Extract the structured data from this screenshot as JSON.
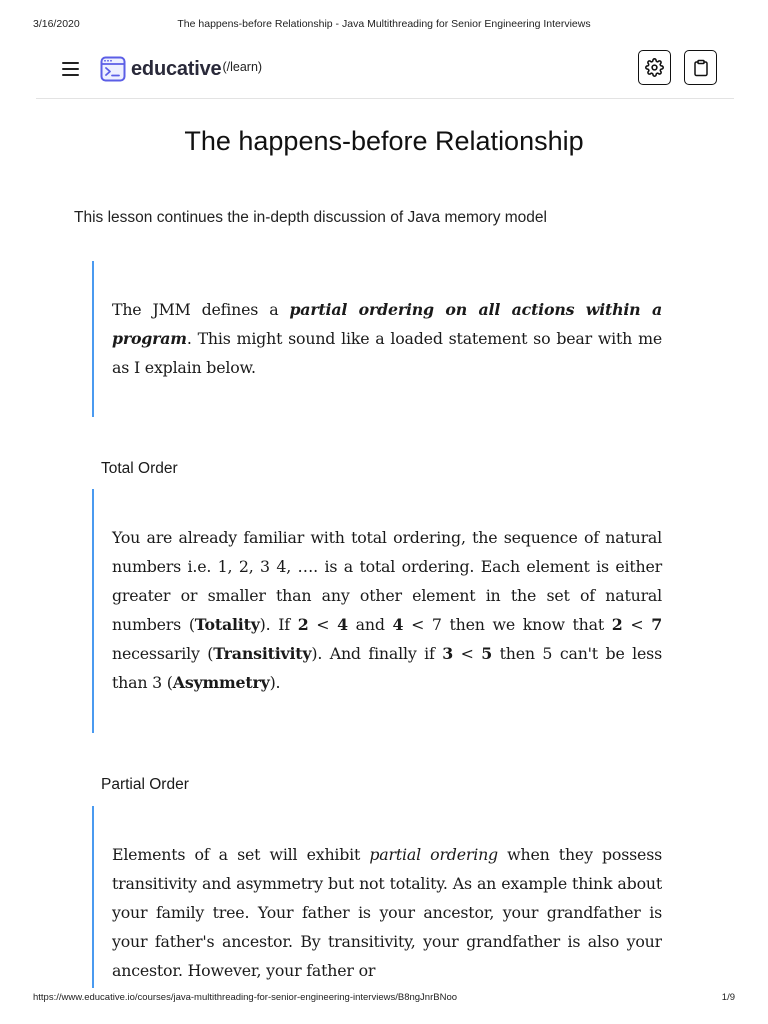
{
  "print": {
    "date": "3/16/2020",
    "doc_title": "The happens-before Relationship - Java Multithreading for Senior Engineering Interviews",
    "url": "https://www.educative.io/courses/java-multithreading-for-senior-engineering-interviews/B8ngJnrBNoo",
    "page": "1/9"
  },
  "nav": {
    "logo_text": "educative",
    "logo_suffix": "(/learn)",
    "icons": {
      "menu": "hamburger-menu-icon",
      "settings": "gear-icon",
      "clipboard": "clipboard-icon"
    }
  },
  "lesson": {
    "title": "The happens-before Relationship",
    "description": "This lesson continues the in-depth discussion of Java memory model",
    "intro": {
      "t1": "The JMM defines a ",
      "t2": "partial ordering on all actions within a program",
      "t3": ". This might sound like a loaded statement so bear with me as I explain below."
    },
    "total_order": {
      "heading": "Total Order",
      "t1": "You are already familiar with total ordering, the sequence of natural numbers i.e. 1, 2, 3 4, …. is a total ordering. Each element is either greater or smaller than any other element in the set of natural numbers (",
      "b1": "Totality",
      "t2": "). If ",
      "b2": "2",
      "t3": " < ",
      "b3": "4",
      "t4": " and ",
      "b4": "4",
      "t5": " < 7 then we know that ",
      "b5": "2",
      "t6": " < ",
      "b6": "7",
      "t7": " necessarily (",
      "b7": "Transitivity",
      "t8": "). And finally if ",
      "b8": "3",
      "t9": " < ",
      "b9": "5",
      "t10": " then 5 can't be less than 3 (",
      "b10": "Asymmetry",
      "t11": ")."
    },
    "partial_order": {
      "heading": "Partial Order",
      "t1": "Elements of a set will exhibit ",
      "i1": "partial ordering",
      "t2": " when they possess transitivity and asymmetry but not totality. As an example think about your family tree. Your father is your ancestor, your grandfather is your father's ancestor. By transitivity, your grandfather is also your ancestor. However, your father or"
    }
  }
}
